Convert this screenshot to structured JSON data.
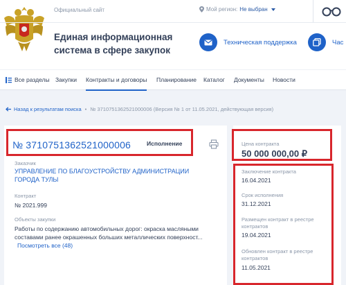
{
  "header": {
    "official_site": "Официальный сайт",
    "region_label": "Мой регион:",
    "region_value": "Не выбран",
    "title": "Единая информационная система в сфере закупок",
    "support_label": "Техническая поддержка",
    "faq_label": "Час"
  },
  "nav": {
    "items": [
      "Все разделы",
      "Закупки",
      "Контракты и договоры",
      "Планирование",
      "Каталог",
      "Документы",
      "Новости"
    ]
  },
  "breadcrumb": {
    "back": "Назад к результатам поиска",
    "separator": "•",
    "current": "№ 3710751362521000006 (Версия № 1 от 11.05.2021, действующая версия)"
  },
  "contract": {
    "number": "№ 3710751362521000006",
    "status": "Исполнение",
    "customer_label": "Заказчик",
    "customer": "УПРАВЛЕНИЕ ПО БЛАГОУСТРОЙСТВУ АДМИНИСТРАЦИИ ГОРОДА ТУЛЫ",
    "contract_label": "Контракт",
    "contract_value": "№ 2021.999",
    "objects_label": "Объекты закупки",
    "objects_value": "Работы по содержанию автомобильных дорог: окраска масляными составами ранее окрашенных больших металлических поверхност...",
    "show_all": "Посмотреть все (48)"
  },
  "side": {
    "price_label": "Цена контракта",
    "price_value": "50 000 000,00 ₽",
    "conclusion_label": "Заключение контракта",
    "conclusion_value": "16.04.2021",
    "term_label": "Срок исполнения",
    "term_value": "31.12.2021",
    "placed_label": "Размещен контракт в реестре контрактов",
    "placed_value": "19.04.2021",
    "updated_label": "Обновлен контракт в реестре контрактов",
    "updated_value": "11.05.2021"
  },
  "colors": {
    "accent": "#1f62c8",
    "highlight": "#d8262c",
    "text": "#334059",
    "muted": "#8a96a8"
  }
}
